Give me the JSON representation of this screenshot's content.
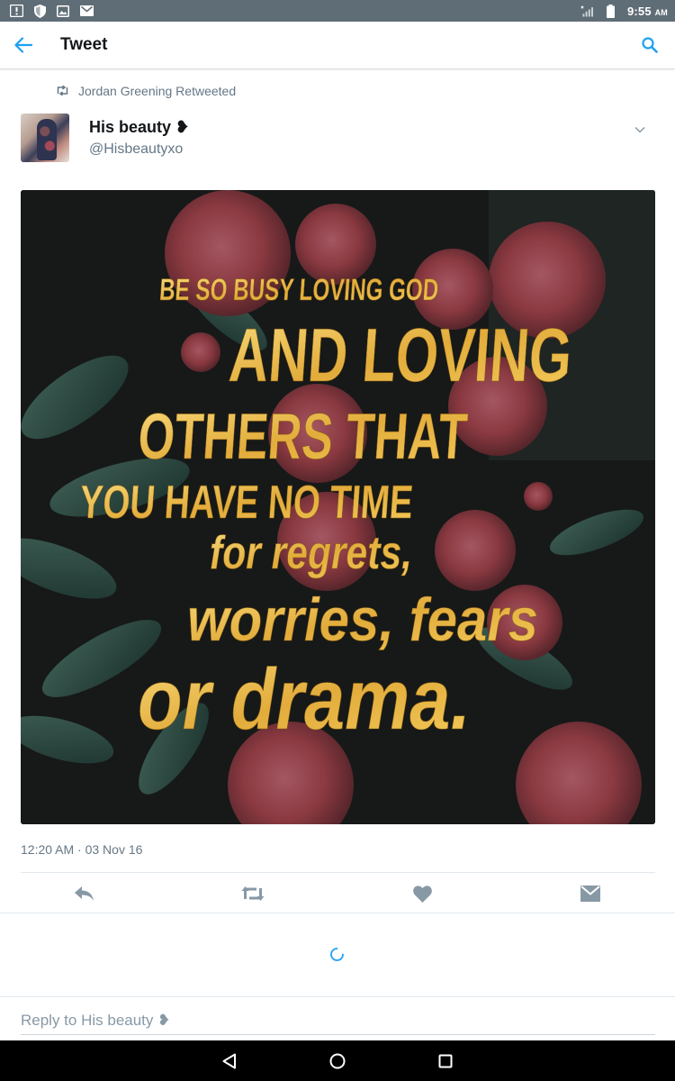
{
  "status_bar": {
    "time": "9:55",
    "ampm": "AM",
    "icons": [
      "alert-icon",
      "shield-icon",
      "image-icon",
      "gmail-icon",
      "no-signal-icon",
      "battery-icon"
    ]
  },
  "app_bar": {
    "title": "Tweet",
    "back_icon": "back-arrow-icon",
    "search_icon": "search-icon"
  },
  "tweet": {
    "retweeted_by": "Jordan Greening Retweeted",
    "author_name": "His beauty ❥",
    "author_handle": "@Hisbeautyxo",
    "image_text_lines": [
      "BE SO BUSY LOVING GOD",
      "AND LOVING",
      "OTHERS THAT",
      "YOU HAVE NO TIME",
      "for regrets,",
      "worries, fears",
      "or drama."
    ],
    "timestamp": "12:20 AM · 03 Nov 16"
  },
  "actions": [
    "reply-icon",
    "retweet-icon",
    "like-icon",
    "direct-message-icon"
  ],
  "reply": {
    "placeholder": "Reply to His beauty ❥"
  },
  "colors": {
    "accent": "#1da1f2",
    "status_bar": "#5f6d76",
    "action_icon": "#8899a6",
    "gold_text": "#e8b84a"
  },
  "nav_bar": [
    "back-triangle-icon",
    "home-circle-icon",
    "recents-square-icon"
  ]
}
